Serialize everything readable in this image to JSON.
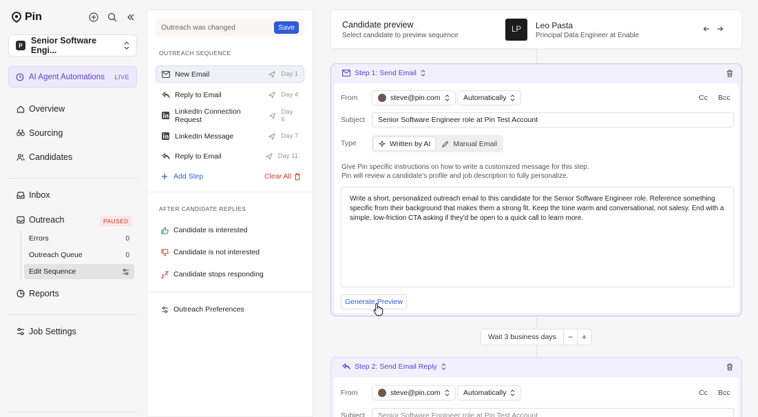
{
  "app": {
    "name": "Pin"
  },
  "sidebar": {
    "job_title": "Senior Software Engi...",
    "job_badge": "P",
    "ai_label": "AI Agent Automations",
    "ai_badge": "LIVE",
    "nav": {
      "overview": "Overview",
      "sourcing": "Sourcing",
      "candidates": "Candidates",
      "inbox": "Inbox",
      "outreach": "Outreach",
      "outreach_badge": "PAUSED",
      "reports": "Reports",
      "job_settings": "Job Settings"
    },
    "outreach_sub": [
      {
        "label": "Errors",
        "count": "0"
      },
      {
        "label": "Outreach Queue",
        "count": "0"
      },
      {
        "label": "Edit Sequence",
        "count": ""
      }
    ]
  },
  "sequence": {
    "changed_text": "Outreach was changed",
    "save_label": "Save",
    "heading": "OUTREACH SEQUENCE",
    "steps": [
      {
        "label": "New Email",
        "day": "Day 1",
        "icon": "mail-icon"
      },
      {
        "label": "Reply to Email",
        "day": "Day 4",
        "icon": "reply-icon"
      },
      {
        "label": "LinkedIn Connection Request",
        "day": "Day 6",
        "icon": "linkedin-icon"
      },
      {
        "label": "LinkedIn Message",
        "day": "Day 7",
        "icon": "linkedin-icon"
      },
      {
        "label": "Reply to Email",
        "day": "Day 11",
        "icon": "reply-icon"
      }
    ],
    "add_step": "Add Step",
    "clear_all": "Clear All",
    "after_heading": "AFTER CANDIDATE REPLIES",
    "replies": [
      {
        "label": "Candidate is interested",
        "icon": "thumbs-up-icon"
      },
      {
        "label": "Candidate is not interested",
        "icon": "thumbs-down-icon"
      },
      {
        "label": "Candidate stops responding",
        "icon": "sleep-icon"
      }
    ],
    "preferences": "Outreach Preferences"
  },
  "preview": {
    "title": "Candidate preview",
    "subtitle": "Select candidate to preview sequence",
    "avatar_initials": "LP",
    "name": "Leo Pasta",
    "role": "Principal Data Engineer at Enable"
  },
  "step1": {
    "title": "Step 1: Send Email",
    "from_label": "From",
    "from_value": "steve@pin.com",
    "send_mode": "Automatically",
    "cc": "Cc",
    "bcc": "Bcc",
    "subject_label": "Subject",
    "subject_value": "Senior Software Engineer role at Pin Test Account",
    "type_label": "Type",
    "type_ai": "Written by AI",
    "type_manual": "Manual Email",
    "instructions_1": "Give Pin specific instructions on how to write a customized message for this step.",
    "instructions_2": "Pin will review a candidate's profile and job description to fully personalize.",
    "prompt": "Write a short, personalized outreach email to this candidate for the Senior Software Engineer role. Reference something specific from their background that makes them a strong fit. Keep the tone warm and conversational, not salesy. End with a simple, low-friction CTA asking if they'd be open to a quick call to learn more.",
    "generate_label": "Generate Preview"
  },
  "wait": {
    "label": "Wait 3 business days",
    "minus": "−",
    "plus": "+"
  },
  "step2": {
    "title": "Step 2: Send Email Reply",
    "from_label": "From",
    "from_value": "steve@pin.com",
    "send_mode": "Automatically",
    "cc": "Cc",
    "bcc": "Bcc",
    "subject_label": "Subject",
    "subject_value": "Senior Software Engineer role at Pin Test Account"
  },
  "colors": {
    "accent": "#2f5bd9",
    "purple": "#5a3fd0",
    "danger": "#d23a2a"
  }
}
